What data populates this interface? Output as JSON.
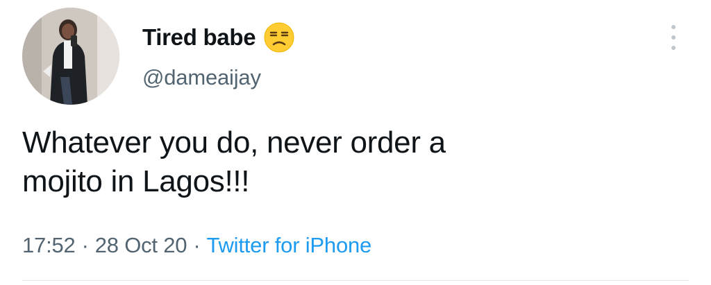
{
  "user": {
    "display_name": "Tired babe",
    "name_emoji": "unamused-face-emoji",
    "handle": "@dameaijay",
    "avatar": "profile-photo"
  },
  "tweet": {
    "text": "Whatever you do, never order a\nmojito in Lagos!!!",
    "time": "17:52",
    "date": "28 Oct 20",
    "source": "Twitter for iPhone",
    "separator": "·"
  },
  "icons": {
    "more": "more-vertical-icon"
  },
  "colors": {
    "text_primary": "#0f1419",
    "text_secondary": "#536471",
    "link": "#1d9bf0",
    "divider": "#e6e9ec"
  }
}
